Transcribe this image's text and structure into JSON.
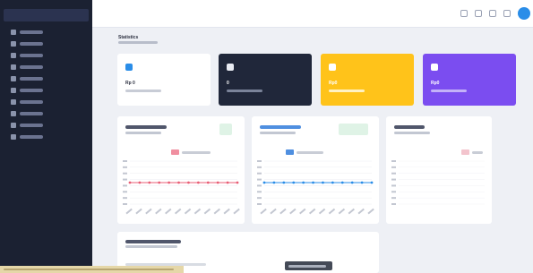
{
  "sidebar": {
    "items": [
      {
        "label": "",
        "icon": "grid-icon"
      },
      {
        "label": "",
        "icon": "gear-icon"
      },
      {
        "label": "",
        "icon": "box-icon"
      },
      {
        "label": "",
        "icon": "list-icon"
      },
      {
        "label": "",
        "icon": "tag-icon"
      },
      {
        "label": "",
        "icon": "cart-icon"
      },
      {
        "label": "",
        "icon": "users-icon"
      },
      {
        "label": "",
        "icon": "chart-icon"
      },
      {
        "label": "",
        "icon": "file-icon"
      },
      {
        "label": "",
        "icon": "report-icon"
      }
    ]
  },
  "header": {
    "title": "Statistics",
    "subtitle": "",
    "icons": [
      "bell-icon",
      "download-icon",
      "refresh-icon",
      "settings-icon"
    ]
  },
  "cards": [
    {
      "value": "Rp 0",
      "label": "",
      "icon": "dollar-icon"
    },
    {
      "value": "0",
      "label": "",
      "icon": "box-icon"
    },
    {
      "value": "Rp0",
      "label": "",
      "icon": "cart-icon"
    },
    {
      "value": "Rp0",
      "label": "",
      "icon": "pie-icon"
    }
  ],
  "panels": [
    {
      "title": "",
      "subtitle": "",
      "badge": "",
      "legend": ""
    },
    {
      "title": "",
      "subtitle": "",
      "badge": "",
      "legend": ""
    },
    {
      "title": "",
      "subtitle": "",
      "legend": ""
    }
  ],
  "bottom_panel": {
    "title": "",
    "subtitle": ""
  },
  "tooltip": "",
  "colors": {
    "sidebar": "#1b2132",
    "accent_blue": "#2a8de8",
    "card_dark": "#20273a",
    "card_yellow": "#ffc31a",
    "card_purple": "#7b4df0",
    "line_red": "#e85d75",
    "badge_green": "#dff3e6"
  },
  "chart_data": [
    {
      "type": "line",
      "title": "",
      "series": [
        {
          "values": [
            0,
            0,
            0,
            0,
            0,
            0,
            0,
            0,
            0,
            0,
            0,
            0
          ]
        }
      ]
    },
    {
      "type": "line",
      "title": "",
      "series": [
        {
          "values": [
            0,
            0,
            0,
            0,
            0,
            0,
            0,
            0,
            0,
            0,
            0,
            0
          ]
        }
      ]
    },
    {
      "type": "pie",
      "title": "",
      "values": []
    }
  ]
}
